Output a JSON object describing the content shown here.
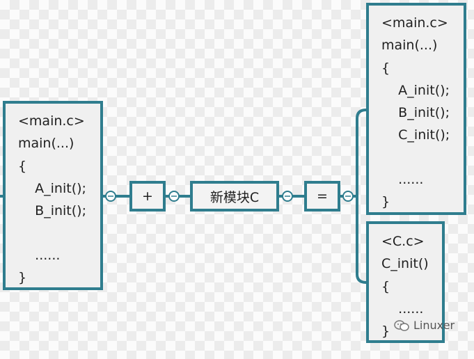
{
  "left_box": {
    "lines": [
      "<main.c>",
      "main(...)",
      "{",
      "    A_init();",
      "    B_init();",
      "",
      "    ......",
      "}"
    ]
  },
  "operators": {
    "plus": "+",
    "module": "新模块C",
    "equals": "="
  },
  "right_top_box": {
    "lines": [
      "<main.c>",
      "main(...)",
      "{",
      "    A_init();",
      "    B_init();",
      "    C_init();",
      "",
      "    ......",
      "}"
    ]
  },
  "right_bottom_box": {
    "lines": [
      "<C.c>",
      "C_init()",
      "{",
      "    ......",
      "}"
    ]
  },
  "watermark": {
    "text": "Linuxer"
  },
  "colors": {
    "border": "#2f7d8e"
  }
}
